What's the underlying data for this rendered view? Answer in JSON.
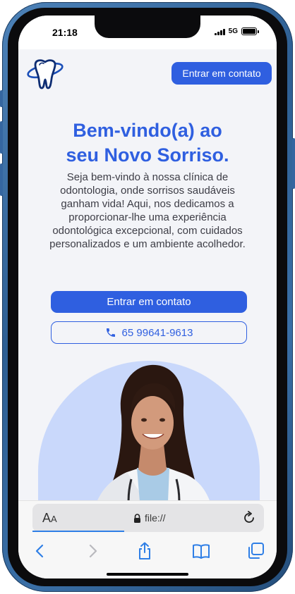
{
  "status_bar": {
    "time": "21:18",
    "network": "5G"
  },
  "header": {
    "cta_label": "Entrar em contato"
  },
  "hero": {
    "title_part1": "Bem-vindo(a) ao",
    "title_part2": "seu ",
    "title_highlight": "Novo Sorriso.",
    "description": "Seja bem-vindo à nossa clínica de odontologia, onde sorrisos saudáveis ganham vida! Aqui, nos dedicamos a proporcionar-lhe uma experiência odontológica excepcional, com cuidados personalizados e um ambiente acolhedor.",
    "primary_cta_label": "Entrar em contato",
    "phone_label": "65 99641-9613"
  },
  "browser": {
    "aa_label_big": "A",
    "aa_label_small": "A",
    "url": "file://"
  },
  "colors": {
    "brand": "#2f5fe0",
    "arch": "#c9d8fb",
    "frame": "#3a6fa6"
  },
  "icons": [
    "tooth-logo",
    "phone-icon",
    "lock-icon",
    "reload-icon",
    "back-icon",
    "forward-icon",
    "share-icon",
    "bookmarks-icon",
    "tabs-icon"
  ]
}
